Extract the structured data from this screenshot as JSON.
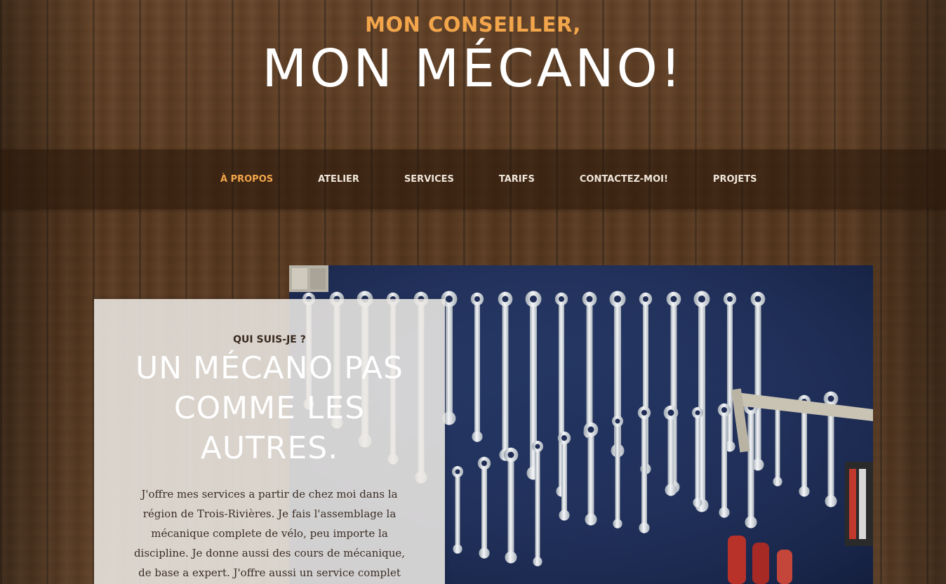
{
  "header": {
    "tagline": "MON CONSEILLER,",
    "title": "MON MÉCANO!"
  },
  "nav": {
    "items": [
      {
        "label": "À PROPOS",
        "active": true
      },
      {
        "label": "ATELIER",
        "active": false
      },
      {
        "label": "SERVICES",
        "active": false
      },
      {
        "label": "TARIFS",
        "active": false
      },
      {
        "label": "CONTACTEZ-MOI!",
        "active": false
      },
      {
        "label": "PROJETS",
        "active": false
      }
    ]
  },
  "about": {
    "kicker": "QUI SUIS-JE ?",
    "heading": "UN MÉCANO PAS COMME LES AUTRES.",
    "body": "J'offre mes services a partir de chez moi dans la région de Trois-Rivières. Je fais l'assemblage la mécanique complete de vélo, peu importe la discipline. Je donne aussi des cours de mécanique, de base a expert. J'offre aussi un service complet d'aide a"
  },
  "colors": {
    "accent": "#f2a54a",
    "nav_text": "#f0e6da",
    "wood": "#5a3a22",
    "card": "#ece8e4"
  }
}
